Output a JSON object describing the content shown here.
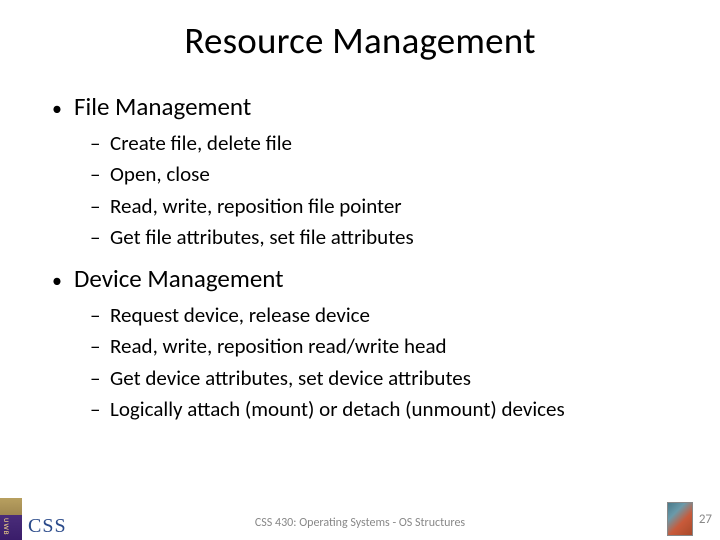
{
  "title": "Resource Management",
  "bullet_char": "•",
  "dash_char": "–",
  "sections": {
    "s0": {
      "heading": "File Management",
      "items": {
        "i0": "Create file, delete file",
        "i1": "Open, close",
        "i2": "Read, write, reposition file pointer",
        "i3": "Get file attributes, set file attributes"
      }
    },
    "s1": {
      "heading": "Device Management",
      "items": {
        "i0": "Request device, release device",
        "i1": "Read, write, reposition read/write head",
        "i2": "Get device attributes, set device attributes",
        "i3": "Logically attach (mount) or detach (unmount) devices"
      }
    }
  },
  "footer": {
    "center": "CSS 430: Operating Systems - OS Structures",
    "page": "27",
    "css_label": "CSS"
  }
}
